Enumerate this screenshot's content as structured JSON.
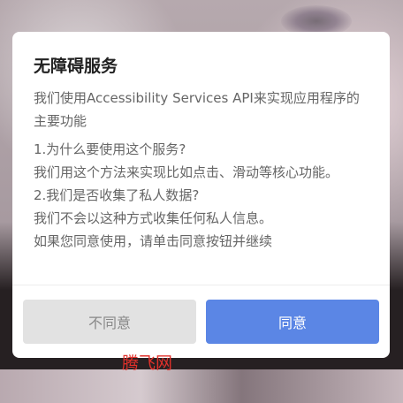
{
  "dialog": {
    "title": "无障碍服务",
    "intro": "我们使用Accessibility Services API来实现应用程序的主要功能",
    "lines": [
      "1.为什么要使用这个服务?",
      "我们用这个方法来实现比如点击、滑动等核心功能。",
      "2.我们是否收集了私人数据?",
      "我们不会以这种方式收集任何私人信息。",
      "如果您同意使用，请单击同意按钮并继续"
    ],
    "disagree_label": "不同意",
    "agree_label": "同意"
  },
  "watermark": "腾飞网",
  "colors": {
    "agree_button": "#5b86e5",
    "disagree_button": "#e2e2e2",
    "watermark": "#e0302a"
  }
}
